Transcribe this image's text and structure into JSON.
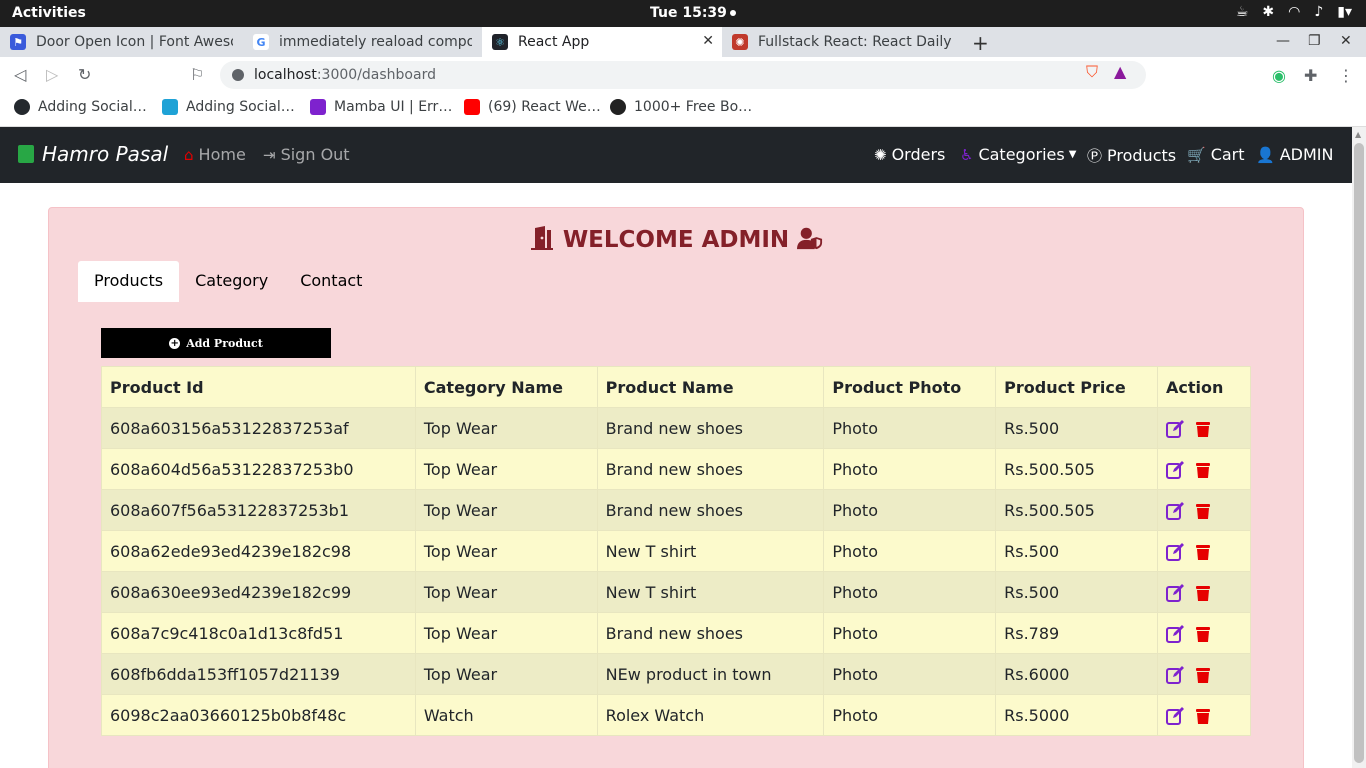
{
  "system": {
    "activities": "Activities",
    "clock": "Tue 15:39"
  },
  "browser": {
    "tabs": [
      {
        "title": "Door Open Icon | Font Aweso",
        "favicon_color": "#3b5bdb"
      },
      {
        "title": "immediately reaload compone",
        "favicon_color": "#4285f4"
      },
      {
        "title": "React App",
        "favicon_color": "#20232a"
      },
      {
        "title": "Fullstack React: React Daily UI",
        "favicon_color": "#c0392b"
      }
    ],
    "url_host": "localhost",
    "url_rest": ":3000/dashboard",
    "bookmarks": [
      {
        "label": "Adding Social…",
        "favicon_color": "#24292e"
      },
      {
        "label": "Adding Social…",
        "favicon_color": "#1fa2d6"
      },
      {
        "label": "Mamba UI | Err…",
        "favicon_color": "#7e22ce"
      },
      {
        "label": "(69) React We…",
        "favicon_color": "#ff0000"
      },
      {
        "label": "1000+ Free Bo…",
        "favicon_color": "#222222"
      }
    ]
  },
  "app": {
    "brand": "Hamro Pasal",
    "nav_left": [
      "Home",
      "Sign Out"
    ],
    "nav_right": [
      "Orders",
      "Categories",
      "Products",
      "Cart",
      "ADMIN"
    ],
    "welcome": "WELCOME ADMIN",
    "tabs": [
      "Products",
      "Category",
      "Contact"
    ],
    "active_tab": "Products",
    "add_button": "Add Product",
    "table": {
      "headers": [
        "Product Id",
        "Category Name",
        "Product Name",
        "Product Photo",
        "Product Price",
        "Action"
      ],
      "rows": [
        [
          "608a603156a53122837253af",
          "Top Wear",
          "Brand new shoes",
          "Photo",
          "Rs.500"
        ],
        [
          "608a604d56a53122837253b0",
          "Top Wear",
          "Brand new shoes",
          "Photo",
          "Rs.500.505"
        ],
        [
          "608a607f56a53122837253b1",
          "Top Wear",
          "Brand new shoes",
          "Photo",
          "Rs.500.505"
        ],
        [
          "608a62ede93ed4239e182c98",
          "Top Wear",
          "New T shirt",
          "Photo",
          "Rs.500"
        ],
        [
          "608a630ee93ed4239e182c99",
          "Top Wear",
          "New T shirt",
          "Photo",
          "Rs.500"
        ],
        [
          "608a7c9c418c0a1d13c8fd51",
          "Top Wear",
          "Brand new shoes",
          "Photo",
          "Rs.789"
        ],
        [
          "608fb6dda153ff1057d21139",
          "Top Wear",
          "NEw product in town",
          "Photo",
          "Rs.6000"
        ],
        [
          "6098c2aa03660125b0b8f48c",
          "Watch",
          "Rolex Watch",
          "Photo",
          "Rs.5000"
        ]
      ]
    },
    "colors": {
      "navbar_bg": "#212529",
      "alert_bg": "#f8d7da",
      "welcome_text": "#842029",
      "edit_icon": "#7e22ce",
      "delete_icon": "#e60000"
    }
  }
}
